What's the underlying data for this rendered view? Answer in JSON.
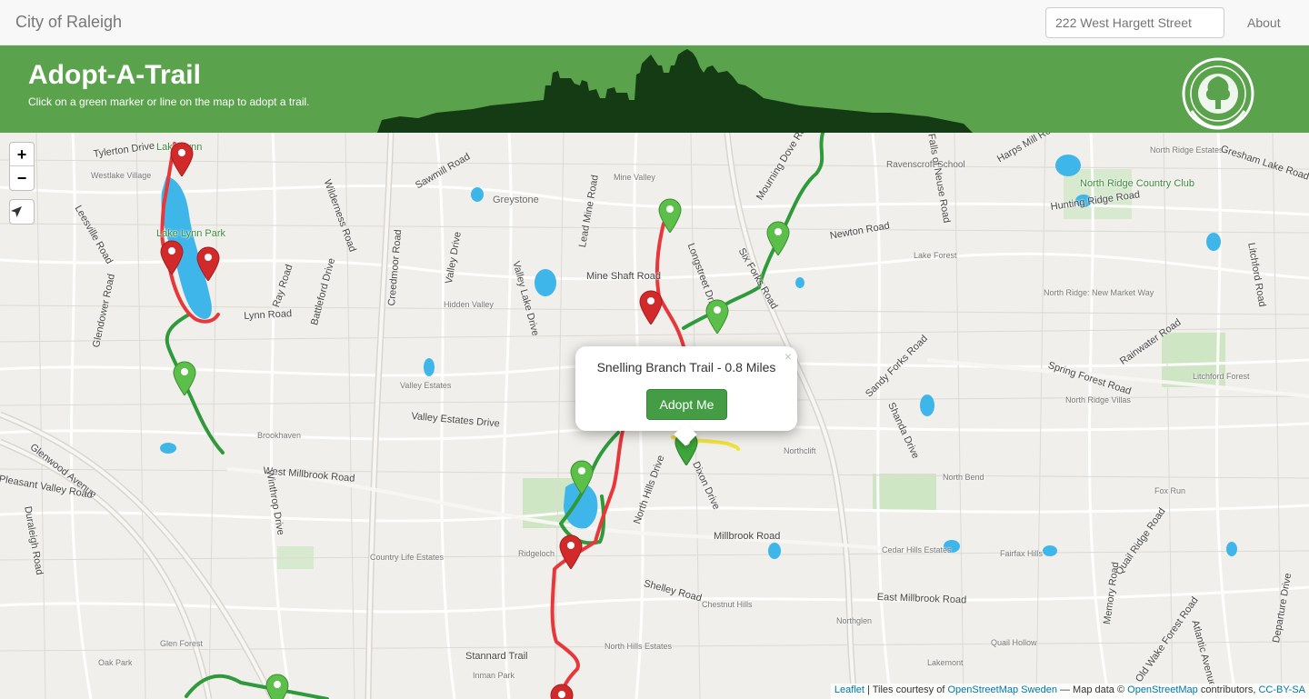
{
  "navbar": {
    "brand": "City of Raleigh",
    "search_placeholder": "222 West Hargett Street",
    "about": "About"
  },
  "header": {
    "title": "Adopt-A-Trail",
    "subtitle": "Click on a green marker or line on the map to adopt a trail."
  },
  "map": {
    "zoom_in": "+",
    "zoom_out": "−",
    "locate_icon": "navigation-arrow-icon",
    "popup": {
      "title": "Snelling Branch Trail - 0.8 Miles",
      "close": "×",
      "button": "Adopt Me"
    },
    "attribution": {
      "leaflet": "Leaflet",
      "tiles_prefix": " | Tiles courtesy of ",
      "osm_sweden": "OpenStreetMap Sweden",
      "data_prefix": " — Map data © ",
      "osm": "OpenStreetMap",
      "contributors": " contributors, ",
      "license": "CC-BY-SA"
    },
    "colors": {
      "adopted_trail": "#e8373a",
      "available_trail": "#2f9a3b",
      "water": "#3eb6ea",
      "selected_trail": "#f0e23a"
    },
    "labels": [
      "Tylerton Drive",
      "Westlake Village",
      "Lake Lynn",
      "Lake Lynn Park",
      "Leesville Road",
      "Glendower Road",
      "Ray Road",
      "Lynn Road",
      "Wilderness Road",
      "Sawmill Road",
      "Greystone",
      "Creedmoor Road",
      "Valley Drive",
      "Hidden Valley",
      "Valley Lake Drive",
      "Lead Mine Road",
      "Mine Valley",
      "Mine Shaft Road",
      "Longstreet Drive",
      "Six Forks Road",
      "Mourning Dove Road",
      "Ravenscroft School",
      "Newton Road",
      "Lake Forest",
      "North Ridge Country Club",
      "Hunting Ridge Road",
      "Harps Mill Road",
      "Falls of Neuse Road",
      "North Ridge Estates",
      "Gresham Lake Road",
      "Litchford Road",
      "North Ridge: New Market Way",
      "Spring Forest Road",
      "Rainwater Road",
      "Litchford Forest",
      "North Ridge Villas",
      "Sandy Forks Road",
      "Shanda Drive",
      "North Bend",
      "Fox Run",
      "Valley Estates",
      "Valley Estates Drive",
      "Battleford Drive",
      "Brookhaven",
      "West Millbrook Road",
      "Glenwood Avenue",
      "Pleasant Valley Road",
      "Duraleigh Road",
      "Winthrop Drive",
      "Country Life Estates",
      "Ridgeloch",
      "Millbrook Road",
      "North Hills Drive",
      "Dixon Drive",
      "Northclift",
      "Shelley Road",
      "Chestnut Hills",
      "Cedar Hills Estates",
      "Fairfax Hills",
      "Quail Ridge Road",
      "East Millbrook Road",
      "Northglen",
      "Quail Hollow",
      "Lakemont",
      "North Hills Estates",
      "Stannard Trail",
      "Inman Park",
      "Glen Forest",
      "Oak Park",
      "Memory Road",
      "Old Wake Forest Road",
      "Atlantic Avenue",
      "Departure Drive"
    ]
  }
}
